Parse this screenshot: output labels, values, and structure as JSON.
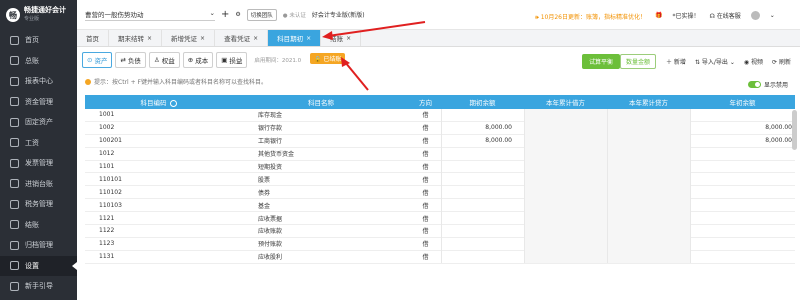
{
  "app": {
    "name": "畅捷通好会计",
    "edition": "专业版"
  },
  "sidebar": {
    "items": [
      {
        "label": "首页"
      },
      {
        "label": "总账"
      },
      {
        "label": "报表中心"
      },
      {
        "label": "资金管理"
      },
      {
        "label": "固定资产"
      },
      {
        "label": "工资"
      },
      {
        "label": "发票管理"
      },
      {
        "label": "进销台账"
      },
      {
        "label": "税务管理"
      },
      {
        "label": "结账"
      },
      {
        "label": "归档管理"
      },
      {
        "label": "设置"
      },
      {
        "label": "新手引导"
      }
    ],
    "active_index": 11
  },
  "topbar": {
    "company": "曹营的一般伤势劝动",
    "switch_org": "切换团队",
    "uncertified": "未认证",
    "version_badge": "好会计专业版(新版)",
    "notice": "10月26日更新：账簿，指标精准优化！",
    "activate": "*已实操！",
    "service": "在线客服",
    "user": "头像"
  },
  "tabs": [
    {
      "label": "首页",
      "closable": false
    },
    {
      "label": "期末结转",
      "closable": true
    },
    {
      "label": "新增凭证",
      "closable": true
    },
    {
      "label": "查看凭证",
      "closable": true
    },
    {
      "label": "科目期初",
      "closable": true,
      "active": true
    },
    {
      "label": "结账",
      "closable": true
    }
  ],
  "toolbar": {
    "categories": [
      {
        "label": "资产",
        "selected": true
      },
      {
        "label": "负债"
      },
      {
        "label": "权益"
      },
      {
        "label": "成本"
      },
      {
        "label": "损益"
      }
    ],
    "period_label": "启用期间：2021.0",
    "closed_badge": "已结账",
    "trial_balance": "试算平衡",
    "quantity_all": "数量金额",
    "add": "新增",
    "import_export": "导入/导出",
    "video": "视频",
    "refresh": "刷新"
  },
  "hint": "提示：按Ctrl + F键并输入科目编码或者科目名称可以查找科目。",
  "show_disabled": "显示禁用",
  "table": {
    "headers": [
      "科目编码",
      "科目名称",
      "方向",
      "期初余额",
      "本年累计借方",
      "本年累计贷方",
      "年初余额"
    ],
    "rows": [
      {
        "code": "1001",
        "name": "库存现金",
        "dir": "借",
        "opening": "",
        "debit": "",
        "credit": "",
        "year_open": ""
      },
      {
        "code": "1002",
        "name": "银行存款",
        "dir": "借",
        "opening": "8,000.00",
        "debit": "",
        "credit": "",
        "year_open": "8,000.00"
      },
      {
        "code": "100201",
        "name": "工商银行",
        "dir": "借",
        "opening": "8,000.00",
        "debit": "",
        "credit": "",
        "year_open": "8,000.00"
      },
      {
        "code": "1012",
        "name": "其他货币资金",
        "dir": "借",
        "opening": "",
        "debit": "",
        "credit": "",
        "year_open": ""
      },
      {
        "code": "1101",
        "name": "短期投资",
        "dir": "借",
        "opening": "",
        "debit": "",
        "credit": "",
        "year_open": ""
      },
      {
        "code": "110101",
        "name": "股票",
        "dir": "借",
        "opening": "",
        "debit": "",
        "credit": "",
        "year_open": ""
      },
      {
        "code": "110102",
        "name": "债券",
        "dir": "借",
        "opening": "",
        "debit": "",
        "credit": "",
        "year_open": ""
      },
      {
        "code": "110103",
        "name": "基金",
        "dir": "借",
        "opening": "",
        "debit": "",
        "credit": "",
        "year_open": ""
      },
      {
        "code": "1121",
        "name": "应收票据",
        "dir": "借",
        "opening": "",
        "debit": "",
        "credit": "",
        "year_open": ""
      },
      {
        "code": "1122",
        "name": "应收账款",
        "dir": "借",
        "opening": "",
        "debit": "",
        "credit": "",
        "year_open": ""
      },
      {
        "code": "1123",
        "name": "预付账款",
        "dir": "借",
        "opening": "",
        "debit": "",
        "credit": "",
        "year_open": ""
      },
      {
        "code": "1131",
        "name": "应收股利",
        "dir": "借",
        "opening": "",
        "debit": "",
        "credit": "",
        "year_open": ""
      }
    ]
  },
  "colors": {
    "accent": "#3aa5df",
    "sidebar_bg": "#2b2f36",
    "green": "#6cbf3a",
    "orange": "#f5a623",
    "arrow": "#e02020"
  }
}
